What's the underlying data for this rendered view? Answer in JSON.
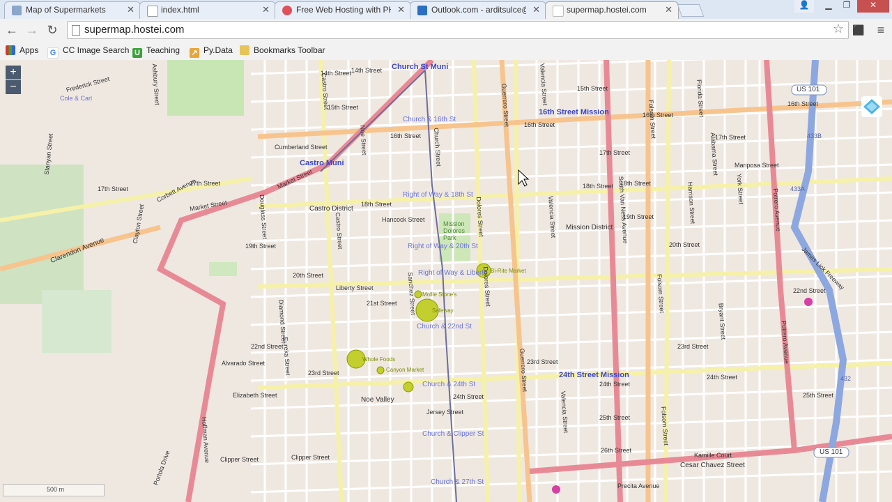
{
  "tabs": [
    {
      "title": "Map of Supermarkets",
      "fav": "map-favicon",
      "color": "#8aa6c9"
    },
    {
      "title": "index.html",
      "fav": "document-favicon",
      "color": "#bbbbbb"
    },
    {
      "title": "Free Web Hosting with PHP",
      "fav": "hosting-favicon",
      "color": "#e0505a"
    },
    {
      "title": "Outlook.com - arditsulce@",
      "fav": "outlook-favicon",
      "color": "#2b6fc4"
    },
    {
      "title": "supermap.hostei.com",
      "fav": "page-favicon",
      "color": "#cccccc"
    }
  ],
  "toolbar": {
    "url": "supermap.hostei.com"
  },
  "bookmarks": [
    {
      "label": "Apps",
      "icon": "apps-icon"
    },
    {
      "label": "CC Image Search",
      "icon": "google-icon"
    },
    {
      "label": "Teaching",
      "icon": "teaching-icon"
    },
    {
      "label": "Py.Data",
      "icon": "pydata-icon"
    },
    {
      "label": "Bookmarks Toolbar",
      "icon": "folder-icon"
    }
  ],
  "map": {
    "zoom_in": "+",
    "zoom_out": "−",
    "scale": "500 m",
    "transit": [
      "Church St Muni",
      "Castro Muni",
      "16th Street Mission",
      "24th Street Mission"
    ],
    "transit_stops": [
      "Church & 16th St",
      "Right of Way & 18th St",
      "Right of Way & 20th St",
      "Right of Way & Liberty",
      "Church & 22nd St",
      "Church & 24th St",
      "Church & Clipper St",
      "Church & 27th St"
    ],
    "parks": [
      "Mission Dolores Park"
    ],
    "districts": [
      "Castro District",
      "Mission District",
      "Noe Valley"
    ],
    "highways": [
      "US 101",
      "433B",
      "433A",
      "432"
    ],
    "streets_ns": [
      "Castro Street",
      "Noe Street",
      "Sanchez Street",
      "Church Street",
      "Dolores Street",
      "Guerrero Street",
      "Valencia Street",
      "South Van Ness Avenue",
      "Folsom Street",
      "Harrison Street",
      "Potrero Avenue",
      "Douglass Street",
      "Diamond Street",
      "Eureka Street",
      "Hoffman Avenue",
      "Stanyan Street",
      "Clayton Street",
      "Ashbury Street",
      "Portola Drive",
      "York Street",
      "Bryant Street",
      "Florida Street",
      "Alabama Street"
    ],
    "streets_ew": [
      "14th Street",
      "15th Street",
      "16th Street",
      "17th Street",
      "18th Street",
      "19th Street",
      "20th Street",
      "21st Street",
      "22nd Street",
      "23rd Street",
      "24th Street",
      "25th Street",
      "26th Street",
      "Market Street",
      "Cesar Chavez Street",
      "Clipper Street",
      "Jersey Street",
      "Elizabeth Street",
      "Frederick Street",
      "Clarendon Avenue",
      "Corbett Avenue",
      "Liberty Street",
      "Hancock Street",
      "Cumberland Street",
      "Mariposa Street",
      "Alvarado Street",
      "Kamille Court",
      "Precita Avenue"
    ],
    "stores": [
      "Bi-Rite Market",
      "Safeway",
      "Mollie Stone's",
      "Whole Foods",
      "Canyon Market",
      "Cole & Carl"
    ],
    "freeways": [
      "James Lick Freeway"
    ]
  }
}
